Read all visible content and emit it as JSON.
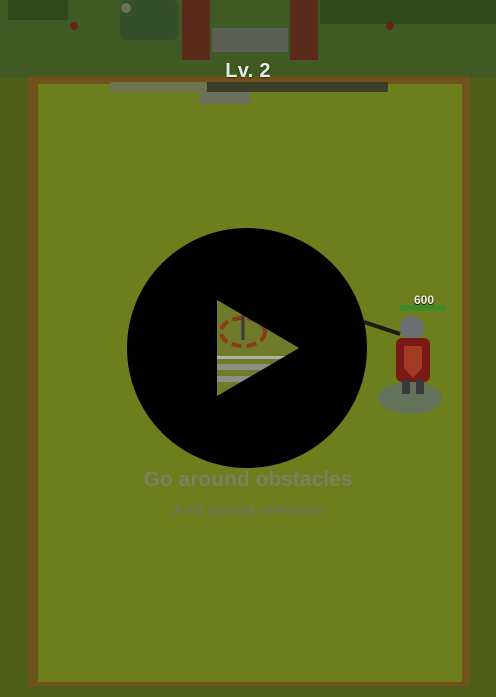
{
  "hud": {
    "level_label": "Lv. 2",
    "level_progress": 0.35
  },
  "enemy": {
    "hp_value": "600",
    "hp_fraction": 1.0
  },
  "tutorial": {
    "title": "Go around obstacles",
    "subtitle": "And defeat enemies"
  },
  "colors": {
    "grass": "#586a1c",
    "arena": "#6e7a1e",
    "wall": "#8a4a1e",
    "play_button": "#000000",
    "play_triangle": "#6c7330"
  }
}
